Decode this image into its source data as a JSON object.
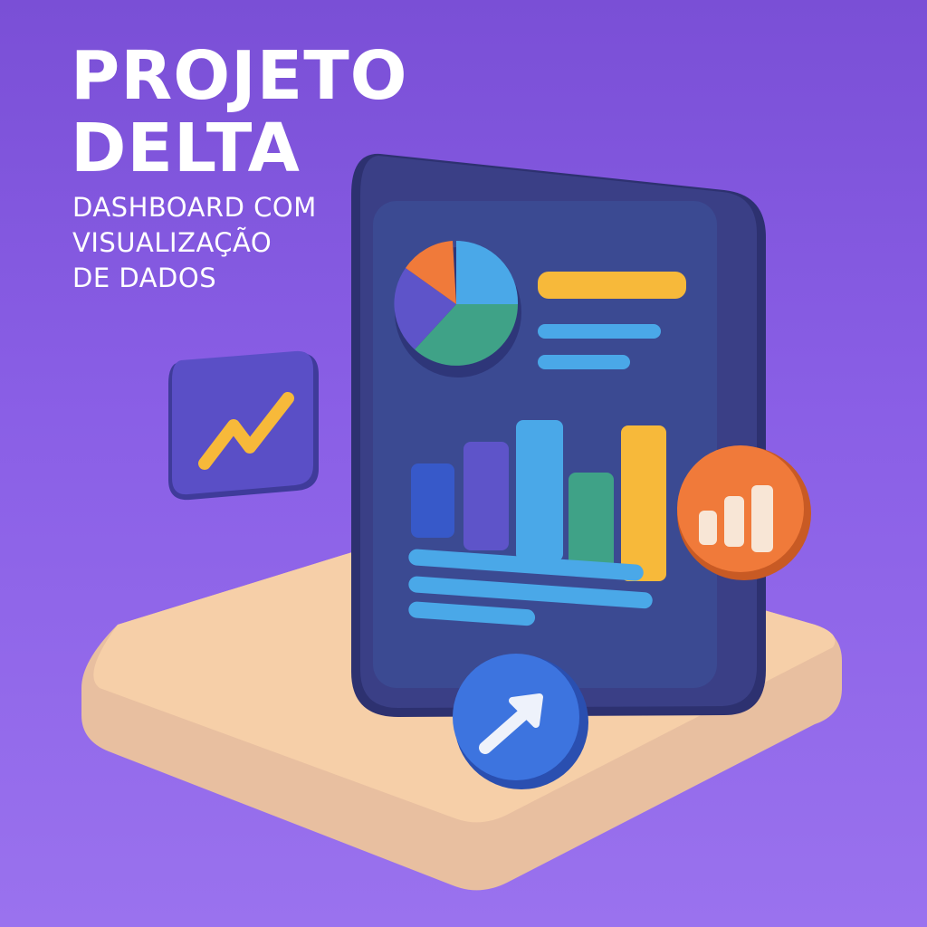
{
  "header": {
    "title_line1": "PROJETO",
    "title_line2": "DELTA",
    "subtitle_line1": "DASHBOARD COM",
    "subtitle_line2": "VISUALIZAÇÃO",
    "subtitle_line3": "DE DADOS"
  },
  "colors": {
    "background": "#7a4fd6",
    "tablet": "#3a3f86",
    "screen": "#3b4a92",
    "platform": "#f6cfa8",
    "yellow": "#f7b93a",
    "blue": "#4aa8e8",
    "green": "#3fa287",
    "orange": "#f07a3a",
    "purple": "#5e54c9"
  },
  "icons": {
    "trend_badge": "trend-line-icon",
    "bar_badge": "bar-chart-icon",
    "arrow_badge": "arrow-up-right-icon"
  }
}
